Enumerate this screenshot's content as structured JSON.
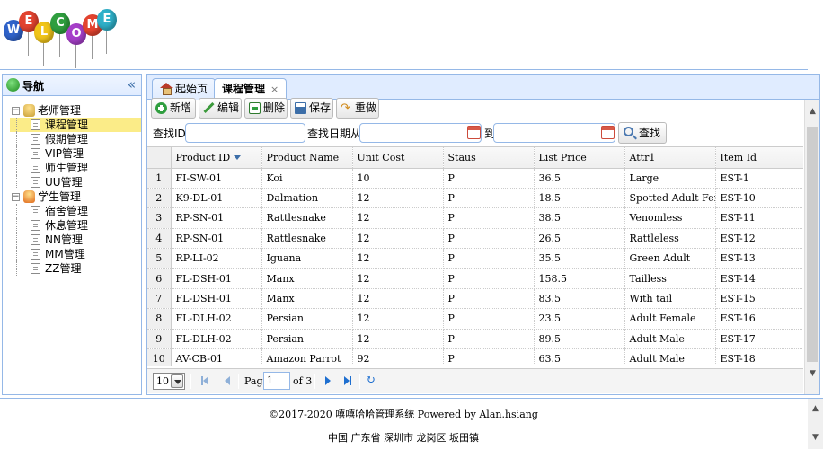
{
  "header": {
    "logo_text": "WELCOME",
    "logo_letters": [
      "W",
      "E",
      "L",
      "C",
      "O",
      "M",
      "E"
    ]
  },
  "nav": {
    "title": "导航",
    "collapse_icon": "double-chevron-left-icon",
    "groups": [
      {
        "label": "老师管理",
        "items": [
          "课程管理",
          "假期管理",
          "VIP管理",
          "师生管理",
          "UU管理"
        ]
      },
      {
        "label": "学生管理",
        "items": [
          "宿舍管理",
          "休息管理",
          "NN管理",
          "MM管理",
          "ZZ管理"
        ]
      }
    ],
    "selected_item": "课程管理"
  },
  "tabs": [
    {
      "label": "起始页",
      "icon": "home-icon"
    },
    {
      "label": "课程管理",
      "closable": true
    }
  ],
  "toolbar": {
    "add_label": "新增",
    "edit_label": "编辑",
    "delete_label": "删除",
    "save_label": "保存",
    "redo_label": "重做"
  },
  "search": {
    "id_label": "查找ID:",
    "date_from_label": "查找日期从",
    "date_to_label": "到",
    "button_label": "查找"
  },
  "grid": {
    "columns": [
      "Product ID",
      "Product Name",
      "Unit Cost",
      "Staus",
      "List Price",
      "Attr1",
      "Item Id"
    ],
    "sorted_column": "Product ID",
    "rows": [
      [
        "1",
        "FI-SW-01",
        "Koi",
        "10",
        "P",
        "36.5",
        "Large",
        "EST-1"
      ],
      [
        "2",
        "K9-DL-01",
        "Dalmation",
        "12",
        "P",
        "18.5",
        "Spotted Adult Female",
        "EST-10"
      ],
      [
        "3",
        "RP-SN-01",
        "Rattlesnake",
        "12",
        "P",
        "38.5",
        "Venomless",
        "EST-11"
      ],
      [
        "4",
        "RP-SN-01",
        "Rattlesnake",
        "12",
        "P",
        "26.5",
        "Rattleless",
        "EST-12"
      ],
      [
        "5",
        "RP-LI-02",
        "Iguana",
        "12",
        "P",
        "35.5",
        "Green Adult",
        "EST-13"
      ],
      [
        "6",
        "FL-DSH-01",
        "Manx",
        "12",
        "P",
        "158.5",
        "Tailless",
        "EST-14"
      ],
      [
        "7",
        "FL-DSH-01",
        "Manx",
        "12",
        "P",
        "83.5",
        "With tail",
        "EST-15"
      ],
      [
        "8",
        "FL-DLH-02",
        "Persian",
        "12",
        "P",
        "23.5",
        "Adult Female",
        "EST-16"
      ],
      [
        "9",
        "FL-DLH-02",
        "Persian",
        "12",
        "P",
        "89.5",
        "Adult Male",
        "EST-17"
      ],
      [
        "10",
        "AV-CB-01",
        "Amazon Parrot",
        "92",
        "P",
        "63.5",
        "Adult Male",
        "EST-18"
      ]
    ]
  },
  "pager": {
    "page_size": "10",
    "page_label": "Page",
    "current_page": "1",
    "of_label": "of 3"
  },
  "footer": {
    "copyright": "©2017-2020 嘻嘻哈哈管理系统 Powered by Alan.hsiang",
    "address": "中国 广东省 深圳市 龙岗区 坂田镇"
  },
  "colors": {
    "border": "#95b8e7",
    "header_bg": "#e0ecff",
    "selected_node": "#fbec88",
    "balloons": [
      "#2f62c9",
      "#e2432f",
      "#f0c419",
      "#2f9e3f",
      "#a63fc9",
      "#e2432f",
      "#2fb0c9"
    ]
  }
}
